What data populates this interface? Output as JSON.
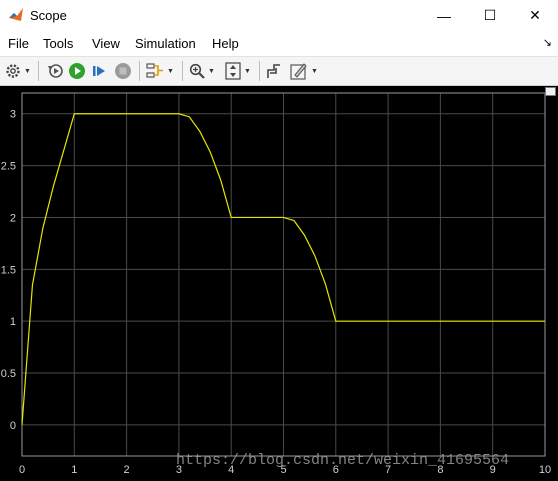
{
  "window": {
    "title": "Scope",
    "minimize_glyph": "—",
    "maximize_glyph": "☐",
    "close_glyph": "✕"
  },
  "menu": {
    "items": [
      "File",
      "Tools",
      "View",
      "Simulation",
      "Help"
    ],
    "overflow_glyph": "↘"
  },
  "toolbar": {
    "icons": [
      "gear-icon",
      "restore-icon",
      "run-icon",
      "step-forward-icon",
      "stop-icon",
      "signal-highlight-icon",
      "zoom-icon",
      "fit-axes-icon",
      "cursor-measure-icon",
      "edit-icon"
    ],
    "colors": {
      "run": "#2fa12f",
      "step": "#2b6fc0",
      "stop": "#9a9a9a"
    }
  },
  "watermark": "https://blog.csdn.net/weixin_41695564",
  "chart_data": {
    "type": "line",
    "background": "#000000",
    "grid": true,
    "grid_color": "#4a4a4a",
    "line_color": "#e6e600",
    "xlim": [
      0,
      10
    ],
    "ylim": [
      -0.3,
      3.2
    ],
    "x_ticks": [
      0,
      1,
      2,
      3,
      4,
      5,
      6,
      7,
      8,
      9,
      10
    ],
    "y_ticks": [
      0,
      0.5,
      1,
      1.5,
      2,
      2.5,
      3
    ],
    "x_tick_labels": [
      "0",
      "1",
      "2",
      "3",
      "4",
      "5",
      "6",
      "7",
      "8",
      "9",
      "10"
    ],
    "y_tick_labels": [
      "0",
      "0.5",
      "1",
      "1.5",
      "2",
      "2.5",
      "3"
    ],
    "series": [
      {
        "x": [
          0,
          0.2,
          0.4,
          0.6,
          0.8,
          1.0,
          2.0,
          3.0,
          3.2,
          3.4,
          3.6,
          3.8,
          4.0,
          5.0,
          5.2,
          5.4,
          5.6,
          5.8,
          6.0,
          10.0
        ],
        "y": [
          0,
          1.35,
          1.9,
          2.3,
          2.65,
          3.0,
          3.0,
          3.0,
          2.97,
          2.83,
          2.63,
          2.36,
          2.0,
          2.0,
          1.97,
          1.83,
          1.63,
          1.36,
          1.0,
          1.0
        ]
      }
    ]
  }
}
